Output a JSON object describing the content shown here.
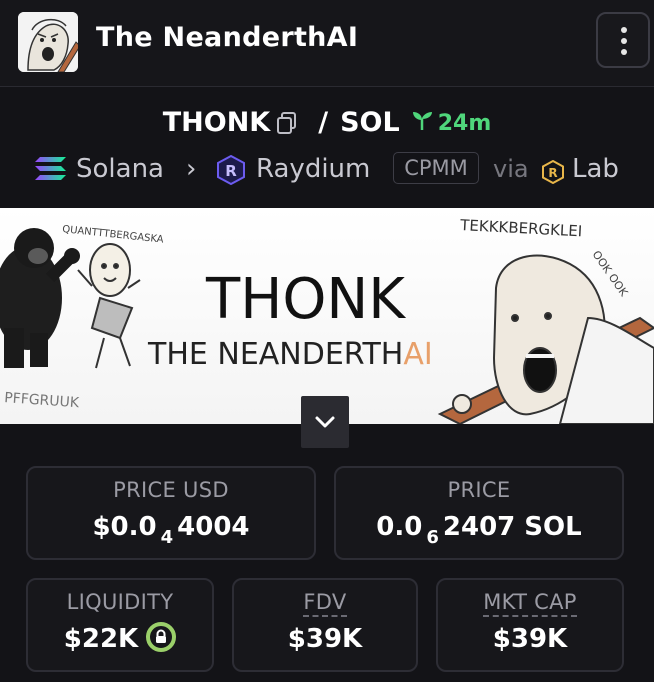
{
  "header": {
    "token_name": "The NeanderthAI"
  },
  "pair": {
    "base": "THONK",
    "separator": "/",
    "quote": "SOL",
    "age": "24m"
  },
  "chain": {
    "network": "Solana",
    "dex": "Raydium",
    "pool_type": "CPMM",
    "via_label": "via",
    "via_source": "Lab"
  },
  "banner": {
    "title": "THONK",
    "subtitle_main": "THE NEANDERTH",
    "subtitle_ai": "AI",
    "left_caption": "QUANTTTBERGASKA",
    "right_caption": "TEKKKBERGKLEI",
    "side_caption": "OOK OOK",
    "bottom_caption": "PFFGRUUK"
  },
  "stats": {
    "price_usd": {
      "label": "PRICE USD",
      "prefix": "$0.0",
      "sub": "4",
      "suffix": "4004"
    },
    "price_sol": {
      "label": "PRICE",
      "prefix": "0.0",
      "sub": "6",
      "suffix": "2407 SOL"
    },
    "liquidity": {
      "label": "LIQUIDITY",
      "value": "$22K"
    },
    "fdv": {
      "label": "FDV",
      "value": "$39K"
    },
    "mkt_cap": {
      "label": "MKT CAP",
      "value": "$39K"
    }
  },
  "colors": {
    "accent_green": "#4fd67b",
    "lock_green": "#9bd06a",
    "ai_orange": "#e8a06a"
  }
}
